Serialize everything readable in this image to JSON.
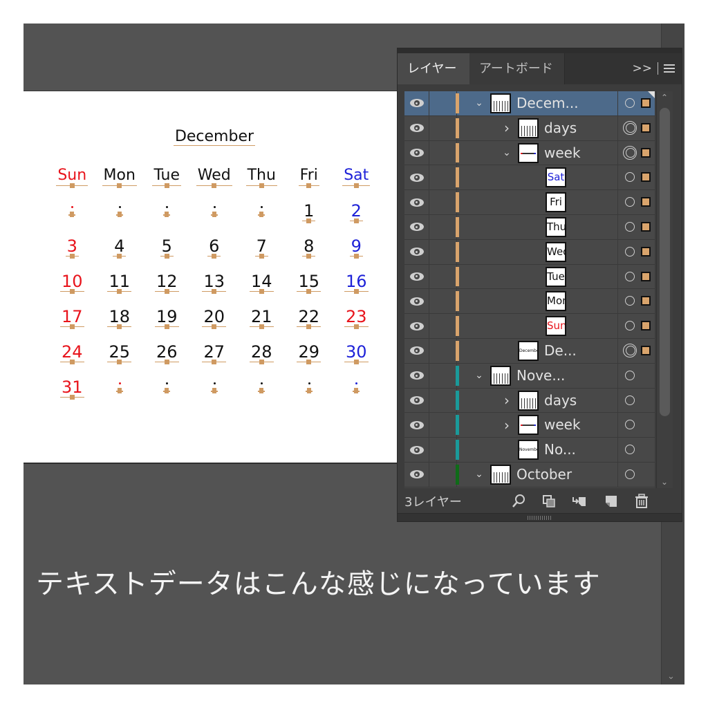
{
  "canvas": {
    "calendar": {
      "month_title": "December",
      "weekday_headers": [
        {
          "label": "Sun",
          "color": "red"
        },
        {
          "label": "Mon",
          "color": "black"
        },
        {
          "label": "Tue",
          "color": "black"
        },
        {
          "label": "Wed",
          "color": "black"
        },
        {
          "label": "Thu",
          "color": "black"
        },
        {
          "label": "Fri",
          "color": "black"
        },
        {
          "label": "Sat",
          "color": "blue"
        }
      ],
      "weeks": [
        [
          {
            "v": "",
            "c": "red"
          },
          {
            "v": "",
            "c": "black"
          },
          {
            "v": "",
            "c": "black"
          },
          {
            "v": "",
            "c": "black"
          },
          {
            "v": "",
            "c": "black"
          },
          {
            "v": "1",
            "c": "black"
          },
          {
            "v": "2",
            "c": "blue"
          }
        ],
        [
          {
            "v": "3",
            "c": "red"
          },
          {
            "v": "4",
            "c": "black"
          },
          {
            "v": "5",
            "c": "black"
          },
          {
            "v": "6",
            "c": "black"
          },
          {
            "v": "7",
            "c": "black"
          },
          {
            "v": "8",
            "c": "black"
          },
          {
            "v": "9",
            "c": "blue"
          }
        ],
        [
          {
            "v": "10",
            "c": "red"
          },
          {
            "v": "11",
            "c": "black"
          },
          {
            "v": "12",
            "c": "black"
          },
          {
            "v": "13",
            "c": "black"
          },
          {
            "v": "14",
            "c": "black"
          },
          {
            "v": "15",
            "c": "black"
          },
          {
            "v": "16",
            "c": "blue"
          }
        ],
        [
          {
            "v": "17",
            "c": "red"
          },
          {
            "v": "18",
            "c": "black"
          },
          {
            "v": "19",
            "c": "black"
          },
          {
            "v": "20",
            "c": "black"
          },
          {
            "v": "21",
            "c": "black"
          },
          {
            "v": "22",
            "c": "black"
          },
          {
            "v": "23",
            "c": "red"
          }
        ],
        [
          {
            "v": "24",
            "c": "red"
          },
          {
            "v": "25",
            "c": "black"
          },
          {
            "v": "26",
            "c": "black"
          },
          {
            "v": "27",
            "c": "black"
          },
          {
            "v": "28",
            "c": "black"
          },
          {
            "v": "29",
            "c": "black"
          },
          {
            "v": "30",
            "c": "blue"
          }
        ],
        [
          {
            "v": "31",
            "c": "red"
          },
          {
            "v": "",
            "c": "red"
          },
          {
            "v": "",
            "c": "black"
          },
          {
            "v": "",
            "c": "black"
          },
          {
            "v": "",
            "c": "black"
          },
          {
            "v": "",
            "c": "black"
          },
          {
            "v": "",
            "c": "blue"
          }
        ]
      ]
    },
    "caption": "テキストデータはこんな感じになっています"
  },
  "colors": {
    "red": "#e8141c",
    "blue": "#1e22d8",
    "black": "#111111",
    "layer_orange": "#d9a46c",
    "layer_teal": "#1a9a9a",
    "layer_green": "#0f6b18",
    "selection_blue": "#4d6a8a"
  },
  "layers_panel": {
    "tabs": [
      {
        "label": "レイヤー",
        "active": true
      },
      {
        "label": "アートボード",
        "active": false
      }
    ],
    "expand_label": ">>",
    "rows": [
      {
        "name": "Decem...",
        "indent": 0,
        "chevron": "down",
        "thumb": "calendar",
        "color": "orange",
        "target": "single",
        "selected": true,
        "sel_square": true
      },
      {
        "name": "days",
        "indent": 1,
        "chevron": "right",
        "thumb": "calendar",
        "color": "orange",
        "target": "double",
        "selected": false,
        "sel_square": true
      },
      {
        "name": "week",
        "indent": 1,
        "chevron": "down",
        "thumb": "weekline",
        "color": "orange",
        "target": "double",
        "selected": false,
        "sel_square": true
      },
      {
        "name": "",
        "indent": 2,
        "chevron": "",
        "thumb_text": "Sat",
        "thumb_color": "blue",
        "color": "orange",
        "target": "single",
        "selected": false,
        "sel_square": true
      },
      {
        "name": "",
        "indent": 2,
        "chevron": "",
        "thumb_text": "Fri",
        "thumb_color": "black",
        "color": "orange",
        "target": "single",
        "selected": false,
        "sel_square": true
      },
      {
        "name": "",
        "indent": 2,
        "chevron": "",
        "thumb_text": "Thu",
        "thumb_color": "black",
        "color": "orange",
        "target": "single",
        "selected": false,
        "sel_square": true
      },
      {
        "name": "",
        "indent": 2,
        "chevron": "",
        "thumb_text": "Wed",
        "thumb_color": "black",
        "color": "orange",
        "target": "single",
        "selected": false,
        "sel_square": true
      },
      {
        "name": "",
        "indent": 2,
        "chevron": "",
        "thumb_text": "Tue",
        "thumb_color": "black",
        "color": "orange",
        "target": "single",
        "selected": false,
        "sel_square": true
      },
      {
        "name": "",
        "indent": 2,
        "chevron": "",
        "thumb_text": "Mon",
        "thumb_color": "black",
        "color": "orange",
        "target": "single",
        "selected": false,
        "sel_square": true
      },
      {
        "name": "",
        "indent": 2,
        "chevron": "",
        "thumb_text": "Sun",
        "thumb_color": "red",
        "color": "orange",
        "target": "single",
        "selected": false,
        "sel_square": true
      },
      {
        "name": "De...",
        "indent": 1,
        "chevron": "",
        "thumb_text": "December",
        "thumb_color": "black",
        "color": "orange",
        "target": "double",
        "selected": false,
        "sel_square": true
      },
      {
        "name": "Nove...",
        "indent": 0,
        "chevron": "down",
        "thumb": "calendar",
        "color": "teal",
        "target": "single",
        "selected": false,
        "sel_square": false
      },
      {
        "name": "days",
        "indent": 1,
        "chevron": "right",
        "thumb": "calendar",
        "color": "teal",
        "target": "single",
        "selected": false,
        "sel_square": false
      },
      {
        "name": "week",
        "indent": 1,
        "chevron": "right",
        "thumb": "weekline",
        "color": "teal",
        "target": "single",
        "selected": false,
        "sel_square": false
      },
      {
        "name": "No...",
        "indent": 1,
        "chevron": "",
        "thumb_text": "November",
        "thumb_color": "black",
        "color": "teal",
        "target": "single",
        "selected": false,
        "sel_square": false
      },
      {
        "name": "October",
        "indent": 0,
        "chevron": "down",
        "thumb": "calendar",
        "color": "green",
        "target": "single",
        "selected": false,
        "sel_square": false
      }
    ],
    "footer": {
      "layer_count": "3レイヤー",
      "icons": [
        "search-icon",
        "clipping-mask-icon",
        "move-to-layer-icon",
        "new-layer-icon",
        "trash-icon"
      ]
    }
  }
}
